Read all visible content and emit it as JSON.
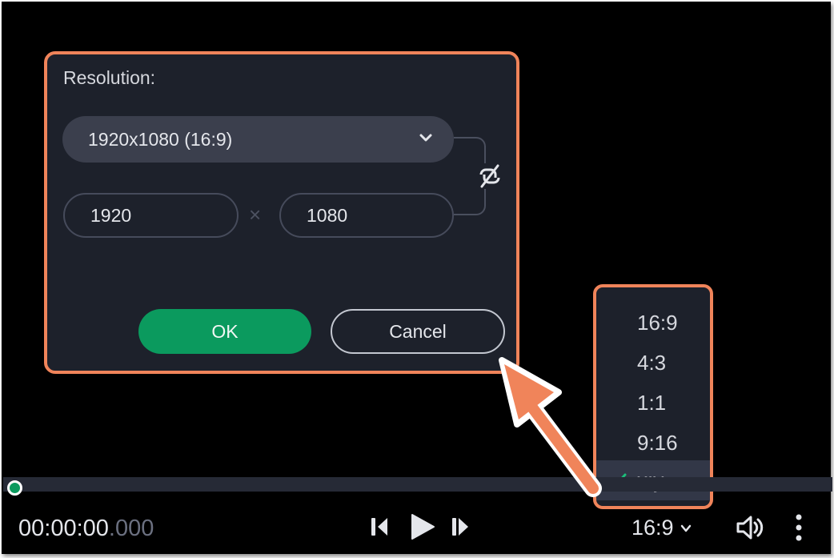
{
  "dialog": {
    "title": "Resolution:",
    "preset_value": "1920x1080 (16:9)",
    "width_value": "1920",
    "height_value": "1080",
    "times_sign": "×",
    "ok_label": "OK",
    "cancel_label": "Cancel",
    "link_icon": "unlink-icon",
    "preset_icon": "chevron-down-icon"
  },
  "aspect_menu": {
    "options": [
      {
        "label": "16:9",
        "selected": false
      },
      {
        "label": "4:3",
        "selected": false
      },
      {
        "label": "1:1",
        "selected": false
      },
      {
        "label": "9:16",
        "selected": false
      },
      {
        "label": "x:y",
        "selected": true
      }
    ],
    "selected_icon": "check-icon"
  },
  "player": {
    "timecode_main": "00:00:00",
    "timecode_ms": ".000",
    "aspect_value": "16:9",
    "icons": [
      "prev-frame-icon",
      "play-icon",
      "next-frame-icon",
      "chevron-down-icon",
      "volume-icon",
      "more-icon"
    ]
  },
  "colors": {
    "highlight": "#f0845a",
    "accent_green": "#0b9a5e",
    "panel": "#1d212b",
    "field": "#3b3f4d",
    "background": "#000000"
  }
}
